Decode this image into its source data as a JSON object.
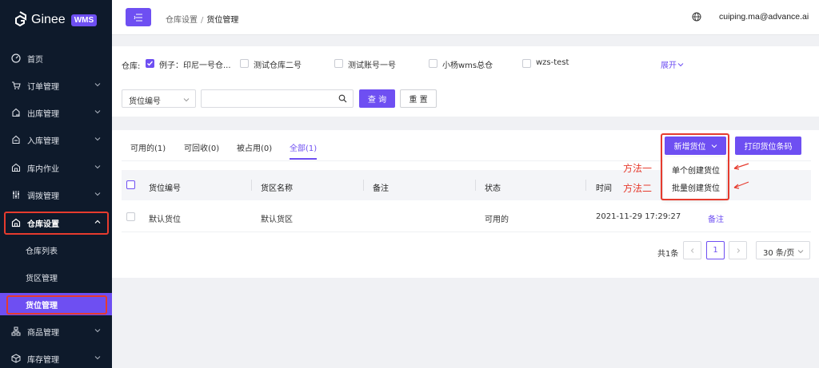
{
  "brand": {
    "name": "Ginee",
    "badge": "WMS"
  },
  "sidebar": {
    "items": [
      {
        "label": "首页",
        "icon": "dashboard-icon"
      },
      {
        "label": "订单管理",
        "icon": "cart-icon"
      },
      {
        "label": "出库管理",
        "icon": "outbound-icon"
      },
      {
        "label": "入库管理",
        "icon": "inbound-icon"
      },
      {
        "label": "库内作业",
        "icon": "warehouse-ops-icon"
      },
      {
        "label": "调拨管理",
        "icon": "transfer-icon"
      },
      {
        "label": "仓库设置",
        "icon": "warehouse-settings-icon"
      },
      {
        "label": "商品管理",
        "icon": "product-icon"
      },
      {
        "label": "库存管理",
        "icon": "inventory-icon"
      }
    ],
    "sub_items": [
      {
        "label": "仓库列表"
      },
      {
        "label": "货区管理"
      },
      {
        "label": "货位管理"
      }
    ]
  },
  "header": {
    "breadcrumb": [
      "仓库设置",
      "货位管理"
    ],
    "breadcrumb_sep": "/",
    "user": "cuiping.ma@advance.ai"
  },
  "filter": {
    "warehouse_label": "仓库:",
    "warehouses": [
      {
        "label": "例子：印尼一号仓...",
        "checked": true
      },
      {
        "label": "测试仓库二号",
        "checked": false
      },
      {
        "label": "测试账号一号",
        "checked": false
      },
      {
        "label": "小杨wms总仓",
        "checked": false
      },
      {
        "label": "wzs-test",
        "checked": false
      }
    ],
    "expand_label": "展开",
    "field_select": "货位编号",
    "search_value": "",
    "query_button": "查 询",
    "reset_button": "重 置"
  },
  "tabs": [
    {
      "label": "可用的(1)",
      "active": false
    },
    {
      "label": "可回收(0)",
      "active": false
    },
    {
      "label": "被占用(0)",
      "active": false
    },
    {
      "label": "全部(1)",
      "active": true
    }
  ],
  "actions": {
    "add_button": "新增货位",
    "print_button": "打印货位条码",
    "dropdown": [
      "单个创建货位",
      "批量创建货位"
    ],
    "annotations": [
      "方法一",
      "方法二"
    ]
  },
  "table": {
    "columns": [
      "货位编号",
      "货区名称",
      "备注",
      "状态",
      "时间"
    ],
    "rows": [
      {
        "code": "默认货位",
        "zone": "默认货区",
        "note": "",
        "status": "可用的",
        "time": "2021-11-29 17:29:27",
        "action": "备注"
      }
    ]
  },
  "pagination": {
    "total": "共1条",
    "current": "1",
    "page_size": "30 条/页"
  },
  "colors": {
    "primary": "#6e4ff2",
    "sidebar_bg": "#0e1a2b",
    "annotation": "#e63b2e"
  }
}
